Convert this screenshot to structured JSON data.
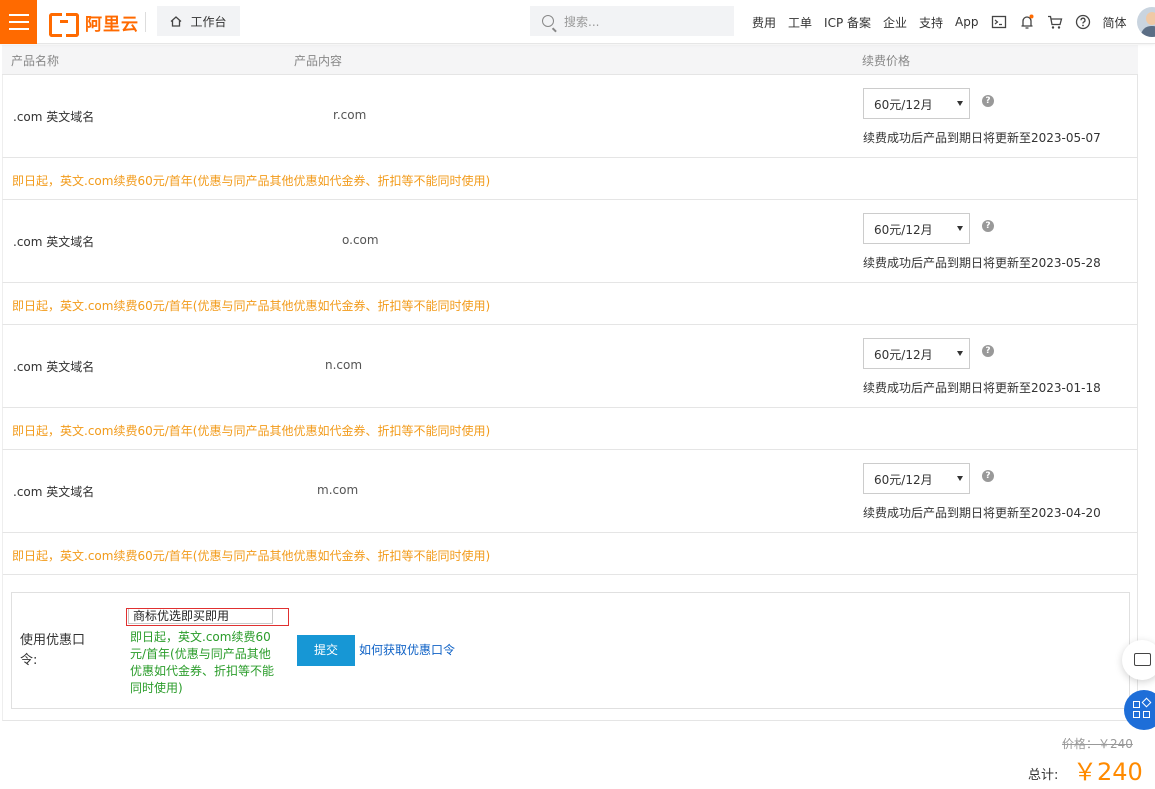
{
  "header": {
    "logo_text": "阿里云",
    "workbench_label": "工作台",
    "search_placeholder": "搜索...",
    "nav": [
      "费用",
      "工单",
      "ICP 备案",
      "企业",
      "支持",
      "App"
    ],
    "lang": "简体",
    "accent_color": "#ff6a00"
  },
  "table": {
    "columns": [
      "产品名称",
      "产品内容",
      "续费价格"
    ],
    "rows": [
      {
        "name": ".com 英文域名",
        "domain": "r.com",
        "price": "60元/12月",
        "expire": "续费成功后产品到期日将更新至2023-05-07",
        "promo": "即日起，英文.com续费60元/首年(优惠与同产品其他优惠如代金券、折扣等不能同时使用)"
      },
      {
        "name": ".com 英文域名",
        "domain": "o.com",
        "price": "60元/12月",
        "expire": "续费成功后产品到期日将更新至2023-05-28",
        "promo": "即日起，英文.com续费60元/首年(优惠与同产品其他优惠如代金券、折扣等不能同时使用)"
      },
      {
        "name": ".com 英文域名",
        "domain": "n.com",
        "price": "60元/12月",
        "expire": "续费成功后产品到期日将更新至2023-01-18",
        "promo": "即日起，英文.com续费60元/首年(优惠与同产品其他优惠如代金券、折扣等不能同时使用)"
      },
      {
        "name": ".com 英文域名",
        "domain": "m.com",
        "price": "60元/12月",
        "expire": "续费成功后产品到期日将更新至2023-04-20",
        "promo": "即日起，英文.com续费60元/首年(优惠与同产品其他优惠如代金券、折扣等不能同时使用)"
      }
    ]
  },
  "coupon": {
    "label": "使用优惠口令:",
    "value": "商标优选即买即用",
    "note": "即日起，英文.com续费60元/首年(优惠与同产品其他优惠如代金券、折扣等不能同时使用)",
    "submit": "提交",
    "howto": "如何获取优惠口令"
  },
  "totals": {
    "price_old": "价格：￥240",
    "total_label": "总计:",
    "total_value": "￥240"
  }
}
